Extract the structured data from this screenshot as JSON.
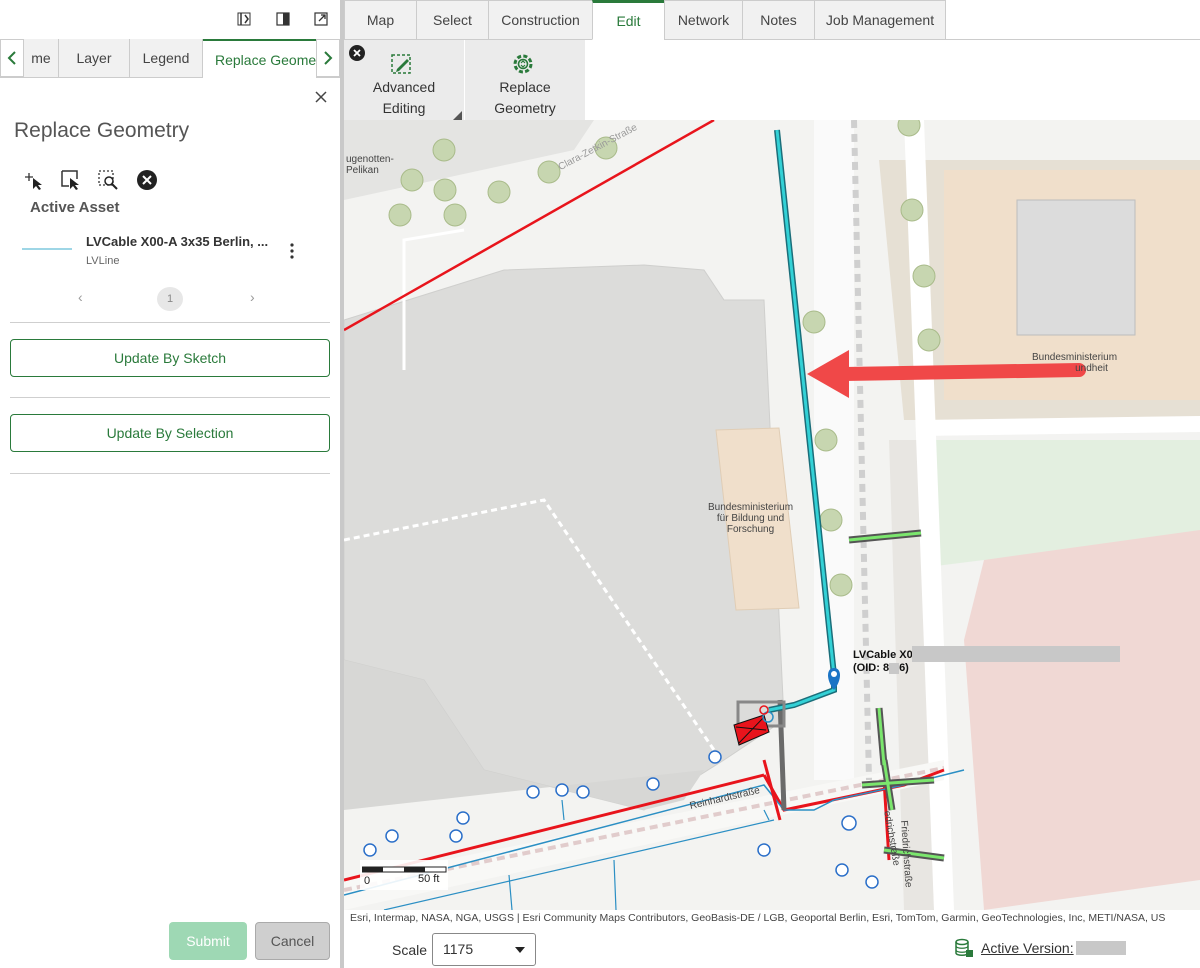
{
  "left_panel": {
    "tabs": [
      "me",
      "Layer",
      "Legend",
      "Replace Geomet"
    ],
    "title": "Replace Geometry",
    "active_asset_label": "Active Asset",
    "asset": {
      "name": "LVCable X00-A 3x35 Berlin, ...",
      "type": "LVLine"
    },
    "pager": {
      "prev": "‹",
      "page": "1",
      "next": "›"
    },
    "update_by_sketch": "Update By Sketch",
    "update_by_selection": "Update By Selection",
    "submit": "Submit",
    "cancel": "Cancel"
  },
  "ribbon": {
    "tabs": [
      "Map",
      "Select",
      "Construction",
      "Edit",
      "Network",
      "Notes",
      "Job Management"
    ],
    "active_tab": "Edit",
    "advanced_editing": [
      "Advanced",
      "Editing"
    ],
    "replace_geometry": [
      "Replace",
      "Geometry"
    ]
  },
  "map": {
    "labels": {
      "hugenotten": [
        "ugenotten-",
        "Pelikan"
      ],
      "street_top": "Clara-Zetkin-Straße",
      "bmg": [
        "Bundesministerium",
        "undheit"
      ],
      "bmbf": [
        "Bundesministerium",
        "für Bildung und",
        "Forschung"
      ],
      "reinhardtstrasse": "Reinhardtstraße",
      "friedrichstrasse": "Friedrichstraße",
      "friedrichstrasse_2": "edrichstraße"
    },
    "feature_label": [
      "LVCable X0",
      "(OID: 8"
    ],
    "feature_label_tail": "6)",
    "scale_bar": {
      "zero": "0",
      "end": "50 ft"
    },
    "attribution": "Esri, Intermap, NASA, NGA, USGS | Esri Community Maps Contributors, GeoBasis-DE / LGB, Geoportal Berlin, Esri, TomTom, Garmin, GeoTechnologies, Inc, METI/NASA, US"
  },
  "bottom_bar": {
    "scale_label": "Scale",
    "scale_value": "1175",
    "active_version": "Active Version: "
  },
  "colors": {
    "accent": "#2a7a3b",
    "cable": "#1aa6a6",
    "arrow": "#f04848",
    "red_line": "#e8141c"
  }
}
